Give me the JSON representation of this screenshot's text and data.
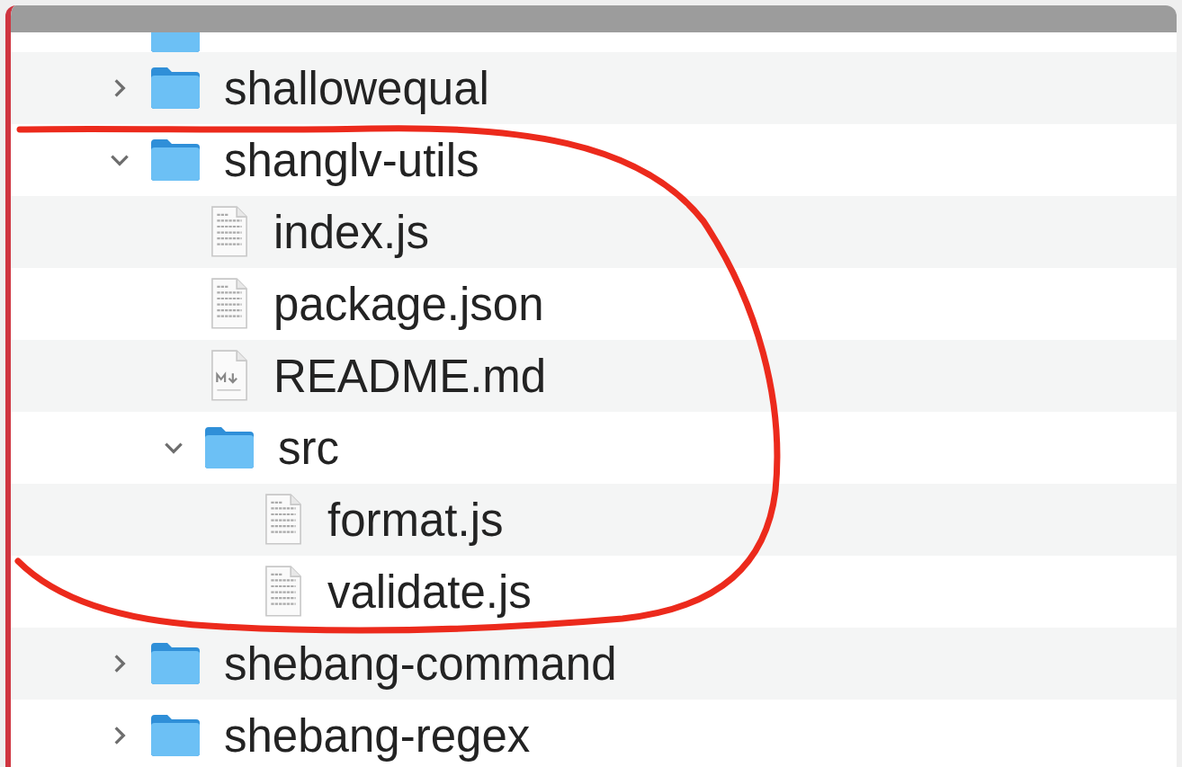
{
  "partial_row": {
    "kind": "folder"
  },
  "tree": [
    {
      "name": "shallowequal",
      "kind": "folder",
      "expanded": false
    },
    {
      "name": "shanglv-utils",
      "kind": "folder",
      "expanded": true,
      "children": [
        {
          "name": "index.js",
          "kind": "file"
        },
        {
          "name": "package.json",
          "kind": "file"
        },
        {
          "name": "README.md",
          "kind": "markdown"
        },
        {
          "name": "src",
          "kind": "folder",
          "expanded": true,
          "children": [
            {
              "name": "format.js",
              "kind": "file"
            },
            {
              "name": "validate.js",
              "kind": "file"
            }
          ]
        }
      ]
    },
    {
      "name": "shebang-command",
      "kind": "folder",
      "expanded": false
    },
    {
      "name": "shebang-regex",
      "kind": "folder",
      "expanded": false
    }
  ]
}
